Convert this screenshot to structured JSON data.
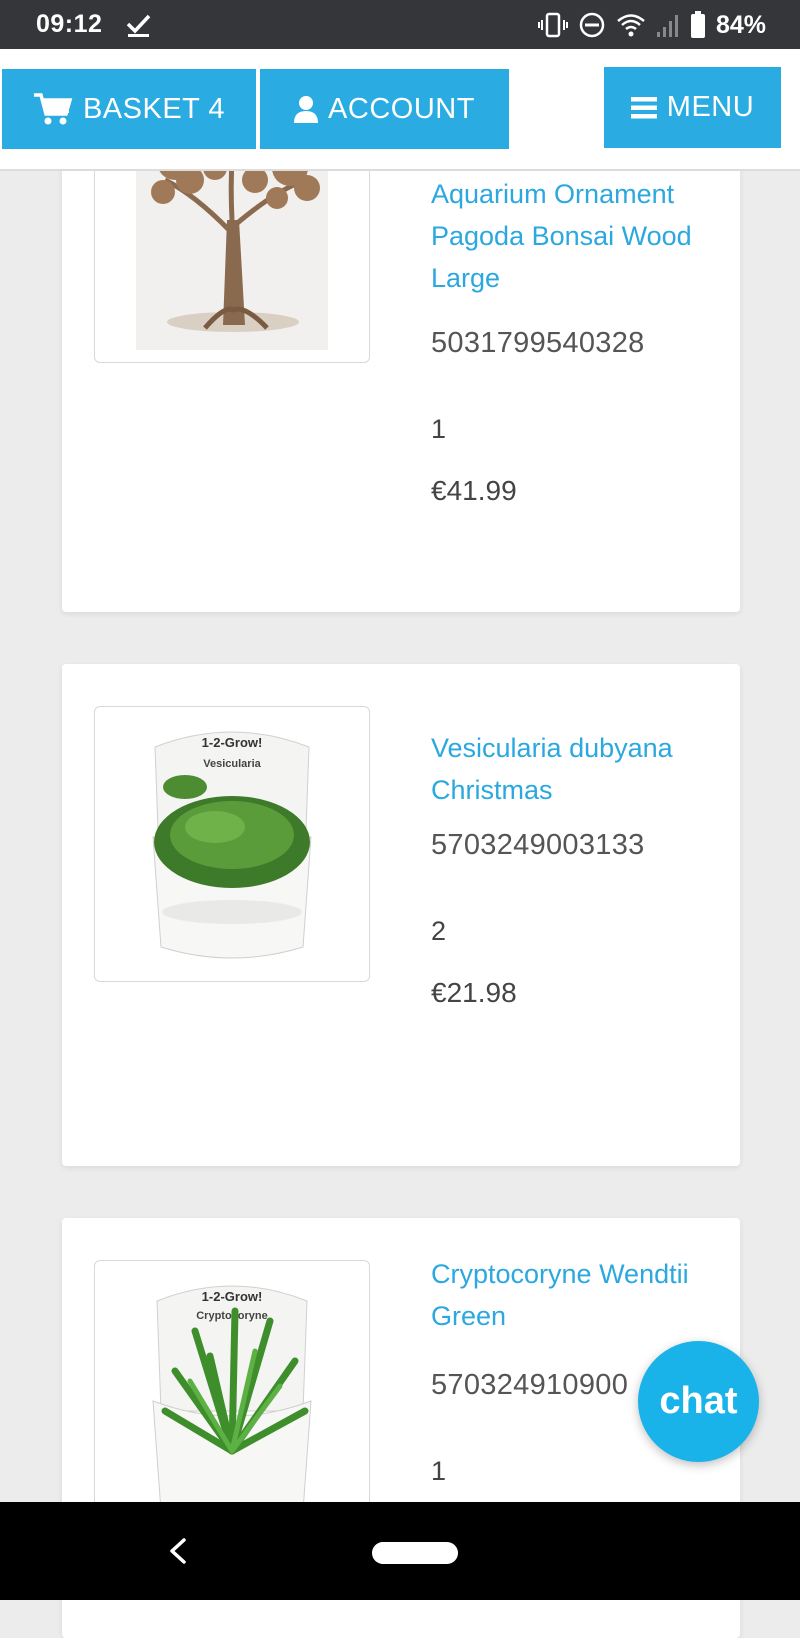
{
  "status_bar": {
    "time": "09:12",
    "battery": "84%"
  },
  "header": {
    "basket_label": "BASKET 4",
    "account_label": "ACCOUNT",
    "menu_label": "MENU"
  },
  "products": [
    {
      "title": "Aquarium Ornament Pagoda Bonsai Wood Large",
      "sku": "5031799540328",
      "qty": "1",
      "price": "€41.99"
    },
    {
      "title": "Vesicularia dubyana Christmas",
      "sku": "5703249003133",
      "qty": "2",
      "price": "€21.98",
      "image_brand": "1-2-Grow!",
      "image_name": "Vesicularia"
    },
    {
      "title": "Cryptocoryne Wendtii Green",
      "sku": "570324910900",
      "qty": "1",
      "image_brand": "1-2-Grow!",
      "image_name": "Cryptocoryne"
    }
  ],
  "chat": {
    "label": "chat"
  },
  "colors": {
    "accent": "#2aace2",
    "status_bar": "#35363a",
    "link": "#2aa8df",
    "chat": "#19b3e9"
  },
  "icons": [
    "check-icon",
    "vibrate-icon",
    "dnd-icon",
    "wifi-icon",
    "signal-icon",
    "battery-icon",
    "cart-icon",
    "user-icon",
    "hamburger-icon",
    "back-icon"
  ]
}
